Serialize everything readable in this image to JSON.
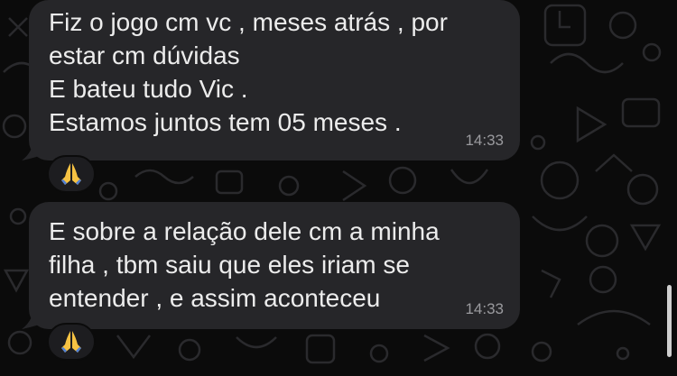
{
  "messages": [
    {
      "lines": [
        "Fiz o jogo cm vc , meses atrás , por",
        "estar cm dúvidas",
        "E bateu tudo Vic .",
        "Estamos juntos tem 05 meses ."
      ],
      "time": "14:33",
      "reaction": "praying-hands"
    },
    {
      "lines": [
        "E sobre a relação dele cm a minha",
        "filha , tbm saiu que eles iriam se",
        "entender , e assim aconteceu"
      ],
      "time": "14:33",
      "reaction": "praying-hands"
    }
  ],
  "colors": {
    "background": "#0b0b0b",
    "bubble": "#262629",
    "text": "#ececec",
    "timestamp": "#9a9a9e",
    "doodle": "#2a2a2d"
  }
}
